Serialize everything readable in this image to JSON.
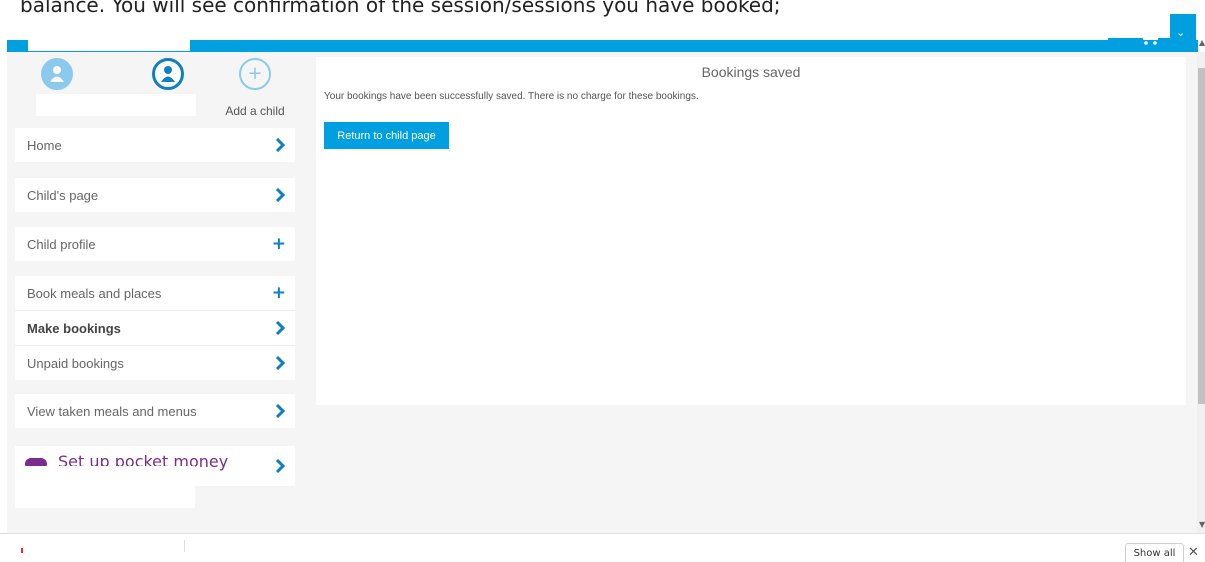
{
  "document": {
    "caption": "balance. You will see confirmation of the session/sessions you have booked;"
  },
  "header": {
    "cart_caret": "⌄",
    "cart_icon": "cart-icon"
  },
  "children": [
    {
      "name": "",
      "icon": "user-icon",
      "color": "#8cc9ee"
    },
    {
      "name": "",
      "icon": "user-icon",
      "color": "#0f7fc4",
      "selected": true
    },
    {
      "label": "Add a child",
      "icon": "plus-circle-icon",
      "symbol": "+"
    }
  ],
  "sidebar": {
    "items": [
      {
        "label": "Home",
        "icon": "chevron-right-icon"
      },
      {
        "label": "Child's page",
        "icon": "chevron-right-icon"
      },
      {
        "label": "Child profile",
        "icon": "plus-icon",
        "symbol": "+"
      },
      {
        "label": "Book meals and places",
        "icon": "plus-icon",
        "symbol": "+"
      },
      {
        "label": "Make bookings",
        "icon": "chevron-right-icon",
        "active": true
      },
      {
        "label": "Unpaid bookings",
        "icon": "chevron-right-icon"
      },
      {
        "label": "View taken meals and menus",
        "icon": "chevron-right-icon"
      }
    ],
    "pocket_money": {
      "label": "Set up pocket money",
      "icon": "nimbl-logo-icon"
    }
  },
  "main": {
    "title": "Bookings saved",
    "message": "Your bookings have been successfully saved. There is no charge for these bookings.",
    "return_button": "Return to child page"
  },
  "download_bar": {
    "show_all": "Show all",
    "close": "✕"
  },
  "colors": {
    "accent": "#009fdf",
    "dark_accent": "#0f7fc4",
    "pocket_money": "#7b2d8e",
    "background": "#f5f5f5"
  }
}
